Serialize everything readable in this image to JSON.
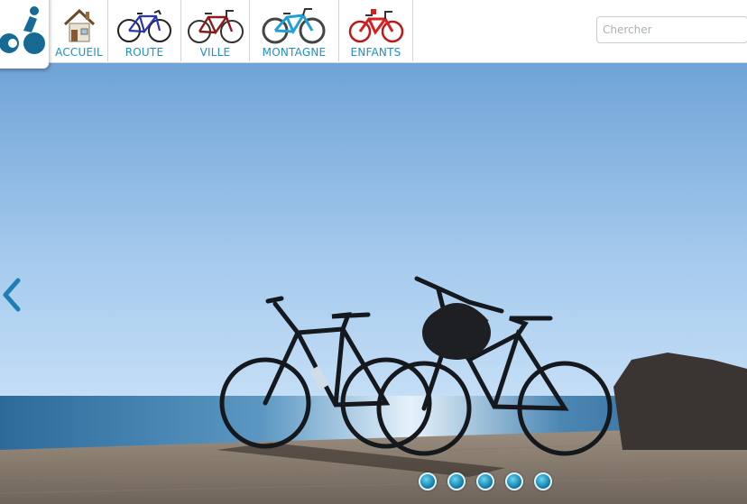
{
  "nav": {
    "items": [
      {
        "label": "ACCUEIL",
        "icon": "house-icon"
      },
      {
        "label": "ROUTE",
        "icon": "road-bike-icon"
      },
      {
        "label": "VILLE",
        "icon": "city-bike-icon"
      },
      {
        "label": "MONTAGNE",
        "icon": "mountain-bike-icon"
      },
      {
        "label": "ENFANTS",
        "icon": "kids-bike-icon"
      }
    ]
  },
  "search": {
    "placeholder": "Chercher"
  },
  "slider": {
    "slide_count": 5,
    "prev_icon": "chevron-left-icon"
  },
  "colors": {
    "accent": "#1e8fc6",
    "logo": "#166a93"
  }
}
